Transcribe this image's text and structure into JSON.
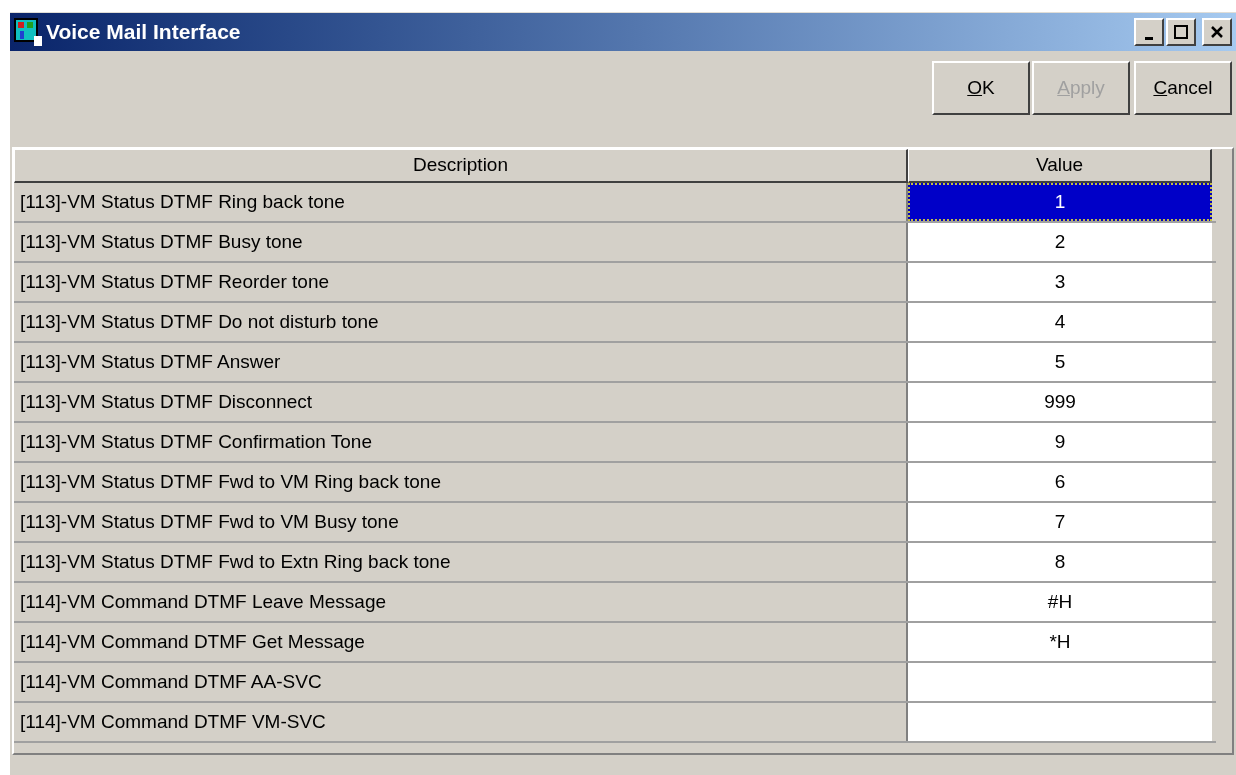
{
  "window": {
    "title": "Voice Mail Interface"
  },
  "buttons": [
    {
      "mnemonic": "O",
      "label_rest": "K",
      "disabled": false
    },
    {
      "mnemonic": "A",
      "label_rest": "pply",
      "disabled": true
    },
    {
      "mnemonic": "C",
      "label_rest": "ancel",
      "disabled": false
    }
  ],
  "table": {
    "columns": [
      "Description",
      "Value"
    ],
    "rows": [
      {
        "description": "[113]-VM Status DTMF Ring back tone",
        "value": "1",
        "selected": true
      },
      {
        "description": "[113]-VM Status DTMF Busy tone",
        "value": "2",
        "selected": false
      },
      {
        "description": "[113]-VM Status DTMF Reorder tone",
        "value": "3",
        "selected": false
      },
      {
        "description": "[113]-VM Status DTMF Do not disturb tone",
        "value": "4",
        "selected": false
      },
      {
        "description": "[113]-VM Status DTMF Answer",
        "value": "5",
        "selected": false
      },
      {
        "description": "[113]-VM Status DTMF Disconnect",
        "value": "999",
        "selected": false
      },
      {
        "description": "[113]-VM Status DTMF Confirmation Tone",
        "value": "9",
        "selected": false
      },
      {
        "description": "[113]-VM Status DTMF Fwd to VM Ring back tone",
        "value": "6",
        "selected": false
      },
      {
        "description": "[113]-VM Status DTMF Fwd to VM Busy tone",
        "value": "7",
        "selected": false
      },
      {
        "description": "[113]-VM Status DTMF Fwd to Extn Ring back tone",
        "value": "8",
        "selected": false
      },
      {
        "description": "[114]-VM Command DTMF Leave Message",
        "value": "#H",
        "selected": false
      },
      {
        "description": "[114]-VM Command DTMF Get Message",
        "value": "*H",
        "selected": false
      },
      {
        "description": "[114]-VM Command DTMF AA-SVC",
        "selected": false
      },
      {
        "description": "[114]-VM Command DTMF VM-SVC",
        "selected": false
      }
    ]
  }
}
